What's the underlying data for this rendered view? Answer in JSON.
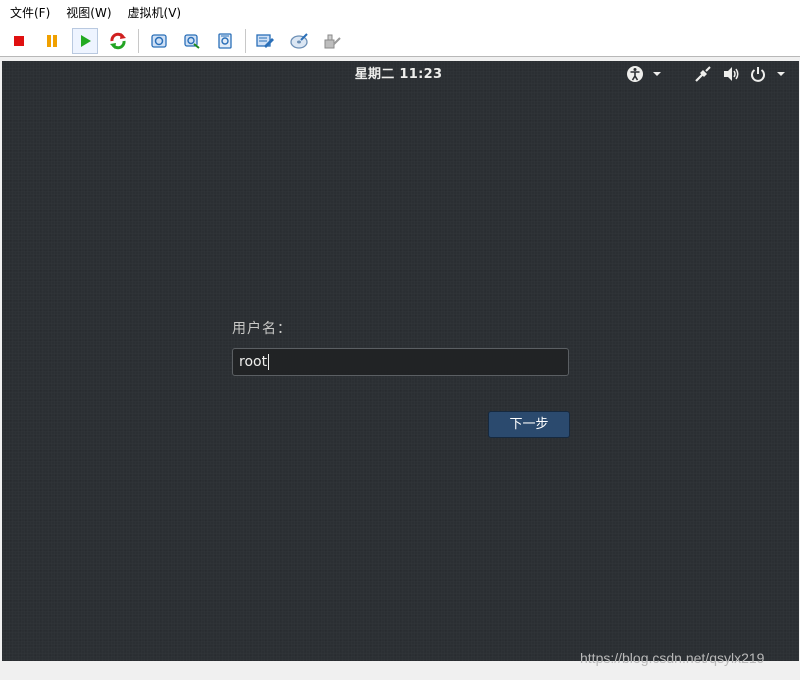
{
  "menubar": {
    "items": [
      {
        "label": "文件(F)"
      },
      {
        "label": "视图(W)"
      },
      {
        "label": "虚拟机(V)"
      }
    ]
  },
  "toolbar": {
    "buttons": [
      {
        "icon": "stop-icon",
        "color": "#e01010"
      },
      {
        "icon": "pause-icon",
        "color": "#f0a000"
      },
      {
        "icon": "play-icon",
        "color": "#22aa22"
      },
      {
        "icon": "refresh-icon",
        "color": "#d02020"
      },
      {
        "icon": "snapshot-icon",
        "color": "#2a6fb8"
      },
      {
        "icon": "snapshot-restore-icon",
        "color": "#2a6fb8"
      },
      {
        "icon": "snapshot-manager-icon",
        "color": "#2a6fb8"
      },
      {
        "icon": "settings-icon",
        "color": "#2a6fb8"
      },
      {
        "icon": "cd-dvd-icon",
        "color": "#2a6fb8"
      },
      {
        "icon": "usb-icon",
        "color": "#999999"
      }
    ]
  },
  "guest": {
    "topbar": {
      "clock": "星期二 11:23",
      "icons": [
        "accessibility-icon",
        "chevron-down-icon",
        "network-icon",
        "volume-icon",
        "power-icon",
        "chevron-down-icon"
      ]
    },
    "login": {
      "label": "用户名：",
      "username": "root",
      "next_label": "下一步"
    }
  },
  "watermark": "https://blog.csdn.net/qsylx219"
}
